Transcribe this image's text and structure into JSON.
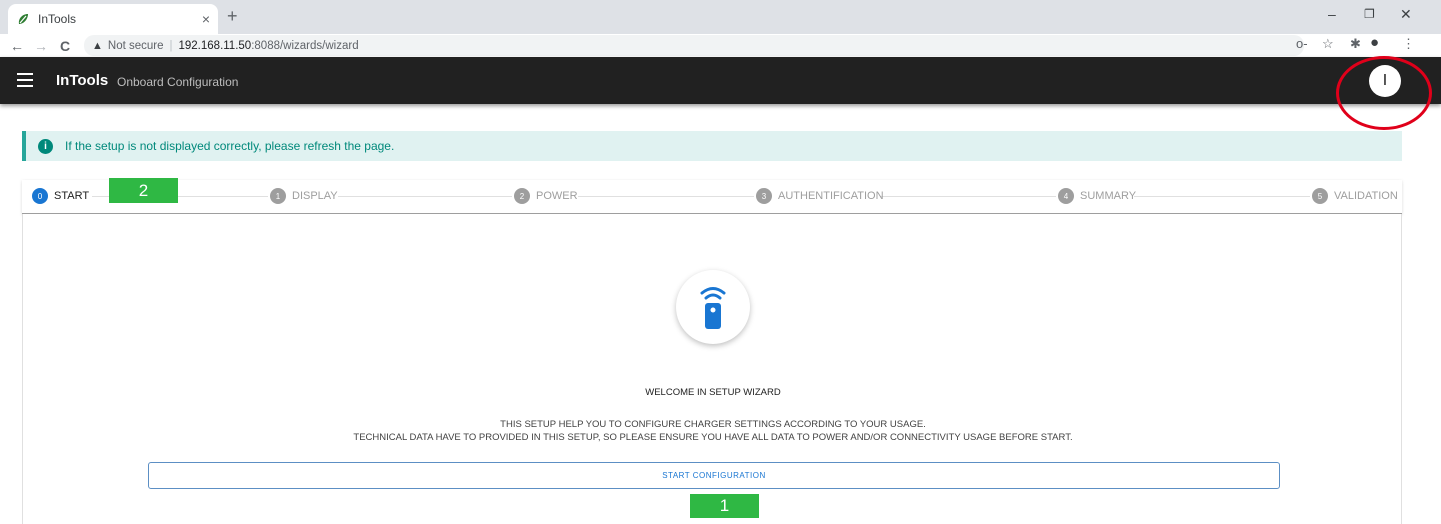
{
  "browser": {
    "tab_title": "InTools",
    "tab_close": "×",
    "new_tab": "+",
    "minimize": "–",
    "restore": "❐",
    "close": "✕",
    "back": "←",
    "forward": "→",
    "reload": "C",
    "security_label": "Not secure",
    "url_host": "192.168.11.50",
    "url_rest": ":8088/wizards/wizard",
    "key_icon": "o-",
    "star_icon": "☆",
    "menu_icon": "⋮"
  },
  "header": {
    "brand": "InTools",
    "subtitle": "Onboard Configuration",
    "user_initial": "I"
  },
  "info_banner": {
    "icon": "i",
    "text": "If the setup is not displayed correctly, please refresh the page."
  },
  "stepper": {
    "steps": [
      {
        "num": "0",
        "label": "START"
      },
      {
        "num": "1",
        "label": "DISPLAY"
      },
      {
        "num": "2",
        "label": "POWER"
      },
      {
        "num": "3",
        "label": "AUTHENTIFICATION"
      },
      {
        "num": "4",
        "label": "SUMMARY"
      },
      {
        "num": "5",
        "label": "VALIDATION"
      }
    ]
  },
  "annotations": {
    "badge_top": "2",
    "badge_bottom": "1"
  },
  "wizard": {
    "title": "WELCOME IN SETUP WIZARD",
    "line1": "THIS SETUP HELP YOU TO CONFIGURE CHARGER SETTINGS ACCORDING TO YOUR USAGE.",
    "line2": "TECHNICAL DATA HAVE TO PROVIDED IN THIS SETUP, SO PLEASE ENSURE YOU HAVE ALL DATA TO POWER AND/OR CONNECTIVITY USAGE BEFORE START.",
    "start_button": "START CONFIGURATION"
  },
  "colors": {
    "header_bg": "#212121",
    "accent": "#1976d2",
    "info_text": "#00897b",
    "annotation_red": "#e0001a",
    "annotation_green": "#2fb844"
  }
}
